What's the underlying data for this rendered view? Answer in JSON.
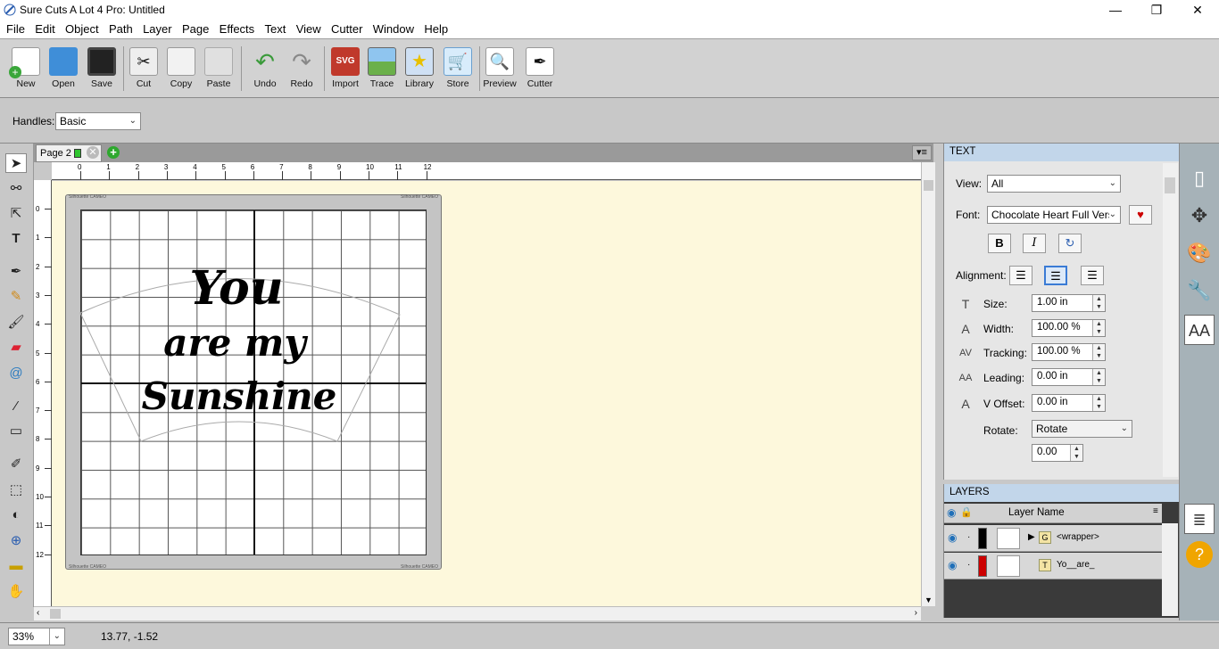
{
  "window": {
    "title": "Sure Cuts A Lot 4 Pro: Untitled",
    "minimize": "—",
    "maximize": "❐",
    "close": "✕"
  },
  "menu": [
    "File",
    "Edit",
    "Object",
    "Path",
    "Layer",
    "Page",
    "Effects",
    "Text",
    "View",
    "Cutter",
    "Window",
    "Help"
  ],
  "toolbar": {
    "buttons": [
      {
        "label": "New",
        "icon": "new-document-icon"
      },
      {
        "label": "Open",
        "icon": "open-folder-icon"
      },
      {
        "label": "Save",
        "icon": "floppy-disk-icon"
      },
      {
        "label": "Cut",
        "icon": "scissors-icon"
      },
      {
        "label": "Copy",
        "icon": "copy-icon"
      },
      {
        "label": "Paste",
        "icon": "paste-icon"
      },
      {
        "label": "Undo",
        "icon": "undo-arrow-icon"
      },
      {
        "label": "Redo",
        "icon": "redo-arrow-icon"
      },
      {
        "label": "Import",
        "icon": "svg-import-icon"
      },
      {
        "label": "Trace",
        "icon": "trace-image-icon"
      },
      {
        "label": "Library",
        "icon": "star-library-icon"
      },
      {
        "label": "Store",
        "icon": "shopping-cart-icon"
      },
      {
        "label": "Preview",
        "icon": "magnifier-preview-icon"
      },
      {
        "label": "Cutter",
        "icon": "pen-cutter-icon"
      }
    ]
  },
  "options": {
    "handles_label": "Handles:",
    "handles_value": "Basic"
  },
  "tabs": {
    "page_tab": "Page 2"
  },
  "ruler": {
    "top_ticks": [
      "0",
      "1",
      "2",
      "3",
      "4",
      "5",
      "6",
      "7",
      "8",
      "9",
      "10",
      "11",
      "12"
    ],
    "left_ticks": [
      "0",
      "1",
      "2",
      "3",
      "4",
      "5",
      "6",
      "7",
      "8",
      "9",
      "10",
      "11",
      "12"
    ]
  },
  "mat": {
    "brand_text": "Silhouette CAMEO"
  },
  "design_text": [
    "You",
    "are my",
    "Sunshine"
  ],
  "text_panel": {
    "header": "TEXT",
    "view_label": "View:",
    "view_value": "All",
    "font_label": "Font:",
    "font_value": "Chocolate Heart Full Versi",
    "bold": "B",
    "italic": "I",
    "refresh": "↻",
    "alignment_label": "Alignment:",
    "size_label": "Size:",
    "size_value": "1.00 in",
    "width_label": "Width:",
    "width_value": "100.00 %",
    "tracking_label": "Tracking:",
    "tracking_value": "100.00 %",
    "leading_label": "Leading:",
    "leading_value": "0.00 in",
    "voffset_label": "V Offset:",
    "voffset_value": "0.00 in",
    "rotate_label": "Rotate:",
    "rotate_mode": "Rotate",
    "rotate_value": "0.00"
  },
  "layers_panel": {
    "header": "LAYERS",
    "column": "Layer Name",
    "rows": [
      {
        "name": "<wrapper>",
        "color": "#000000"
      },
      {
        "name": "Yo__are_",
        "color": "#cc0000"
      }
    ]
  },
  "status": {
    "zoom": "33%",
    "coords": "13.77, -1.52"
  },
  "colors": {
    "accent_panel_header": "#c2d6ea",
    "workarea": "#fdf8dc",
    "toolbar_bg": "#d2d2d2"
  }
}
